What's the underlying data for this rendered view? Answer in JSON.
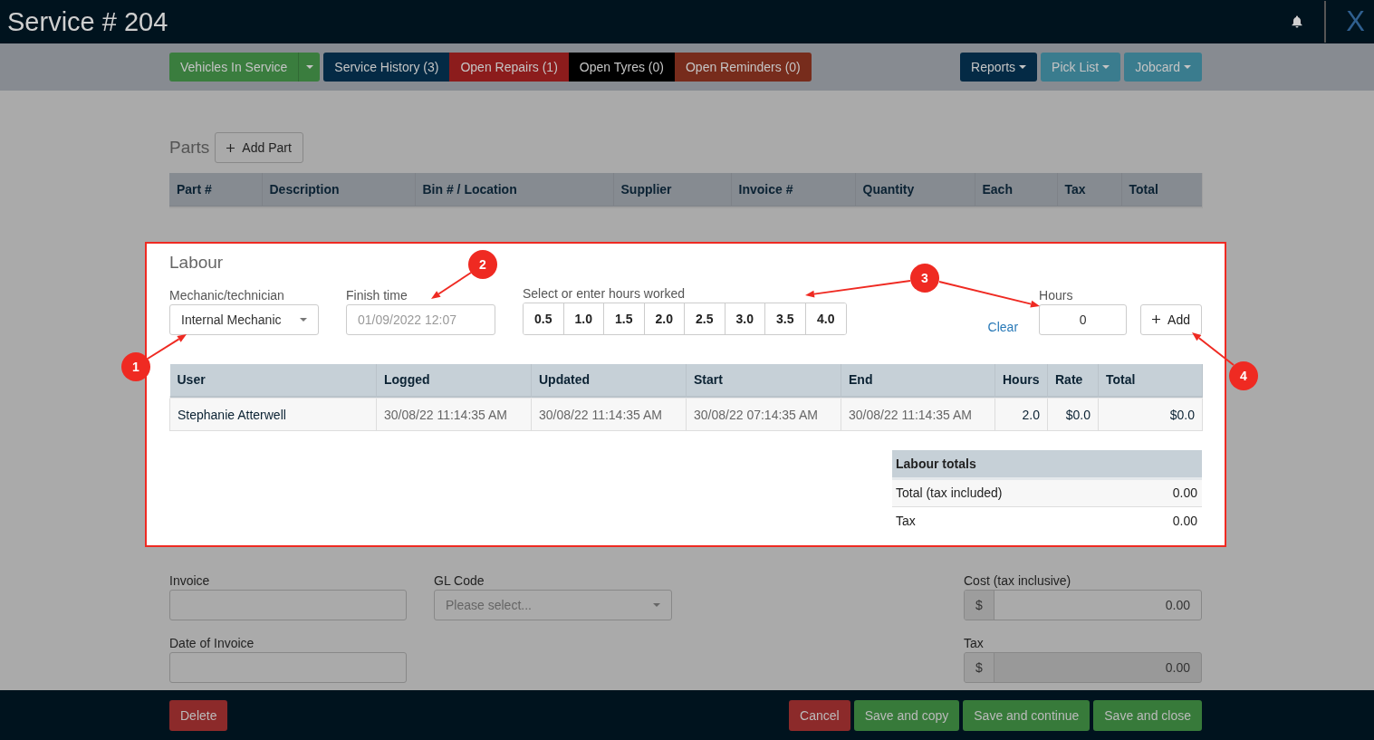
{
  "header": {
    "title": "Service # 204",
    "close": "X"
  },
  "toolbar": {
    "vehicles_button": {
      "label": "Vehicles In Service",
      "color": "#3a7d3e"
    },
    "record_buttons": [
      {
        "label": "Service History (3)",
        "color": "#042a45"
      },
      {
        "label": "Open Repairs (1)",
        "color": "#8c1c1c"
      },
      {
        "label": "Open Tyres (0)",
        "color": "#000000"
      },
      {
        "label": "Open Reminders (0)",
        "color": "#772c1c"
      }
    ],
    "menu_buttons": [
      {
        "label": "Reports",
        "color": "#042a45"
      },
      {
        "label": "Pick List",
        "color": "#3a7c8e"
      },
      {
        "label": "Jobcard",
        "color": "#3a7c8e"
      }
    ]
  },
  "parts": {
    "title": "Parts",
    "add_button": "Add Part",
    "columns": [
      "Part #",
      "Description",
      "Bin # / Location",
      "Supplier",
      "Invoice #",
      "Quantity",
      "Each",
      "Tax",
      "Total"
    ]
  },
  "labour": {
    "title": "Labour",
    "mechanic": {
      "label": "Mechanic/technician",
      "value": "Internal Mechanic"
    },
    "finish_time": {
      "label": "Finish time",
      "placeholder": "01/09/2022 12:07"
    },
    "hours_presets": {
      "label": "Select or enter hours worked",
      "options": [
        "0.5",
        "1.0",
        "1.5",
        "2.0",
        "2.5",
        "3.0",
        "3.5",
        "4.0"
      ]
    },
    "clear": "Clear",
    "hours": {
      "label": "Hours",
      "value": "0"
    },
    "add_button": "Add",
    "table": {
      "columns": [
        "User",
        "Logged",
        "Updated",
        "Start",
        "End",
        "Hours",
        "Rate",
        "Total"
      ],
      "rows": [
        [
          "Stephanie Atterwell",
          "30/08/22 11:14:35 AM",
          "30/08/22 11:14:35 AM",
          "30/08/22 07:14:35 AM",
          "30/08/22 11:14:35 AM",
          "2.0",
          "$0.0",
          "$0.0"
        ]
      ]
    },
    "totals": {
      "title": "Labour totals",
      "rows": [
        {
          "label": "Total (tax included)",
          "value": "0.00"
        },
        {
          "label": "Tax",
          "value": "0.00"
        }
      ]
    }
  },
  "invoice": {
    "label": "Invoice"
  },
  "gl_code": {
    "label": "GL Code",
    "placeholder": "Please select..."
  },
  "date_of_invoice": {
    "label": "Date of Invoice"
  },
  "cost": {
    "label": "Cost (tax inclusive)",
    "prefix": "$",
    "value": "0.00",
    "disabled": false
  },
  "tax": {
    "label": "Tax",
    "prefix": "$",
    "value": "0.00",
    "disabled": true
  },
  "footer": {
    "left": [
      {
        "label": "Delete",
        "color": "#8c2a2a"
      }
    ],
    "right": [
      {
        "label": "Cancel",
        "color": "#8c2a2a"
      },
      {
        "label": "Save and copy",
        "color": "#377a3a"
      },
      {
        "label": "Save and continue",
        "color": "#377a3a"
      },
      {
        "label": "Save and close",
        "color": "#377a3a"
      }
    ]
  },
  "annotations": [
    {
      "number": "1"
    },
    {
      "number": "2"
    },
    {
      "number": "3"
    },
    {
      "number": "4"
    }
  ]
}
